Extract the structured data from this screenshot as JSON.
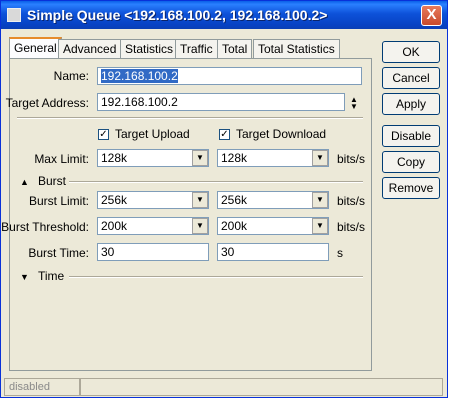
{
  "window": {
    "title": "Simple Queue <192.168.100.2, 192.168.100.2>",
    "close_label": "X"
  },
  "tabs": [
    "General",
    "Advanced",
    "Statistics",
    "Traffic",
    "Total",
    "Total Statistics"
  ],
  "form": {
    "name_label": "Name:",
    "name_value": "192.168.100.2",
    "target_label": "Target Address:",
    "target_value": "192.168.100.2",
    "target_upload_label": "Target Upload",
    "target_upload_checked": true,
    "target_download_label": "Target Download",
    "target_download_checked": true,
    "max_limit_label": "Max Limit:",
    "max_limit_upload": "128k",
    "max_limit_download": "128k",
    "max_limit_unit": "bits/s",
    "burst_section": "Burst",
    "burst_limit_label": "Burst Limit:",
    "burst_limit_upload": "256k",
    "burst_limit_download": "256k",
    "burst_limit_unit": "bits/s",
    "burst_threshold_label": "Burst Threshold:",
    "burst_threshold_upload": "200k",
    "burst_threshold_download": "200k",
    "burst_threshold_unit": "bits/s",
    "burst_time_label": "Burst Time:",
    "burst_time_upload": "30",
    "burst_time_download": "30",
    "burst_time_unit": "s",
    "time_section": "Time"
  },
  "buttons": {
    "ok": "OK",
    "cancel": "Cancel",
    "apply": "Apply",
    "disable": "Disable",
    "copy": "Copy",
    "remove": "Remove"
  },
  "status": {
    "state": "disabled"
  },
  "colors": {
    "titlebar": "#0a5fe8",
    "dialog_bg": "#ece9d8",
    "active_tab_accent": "#e68b2c"
  }
}
